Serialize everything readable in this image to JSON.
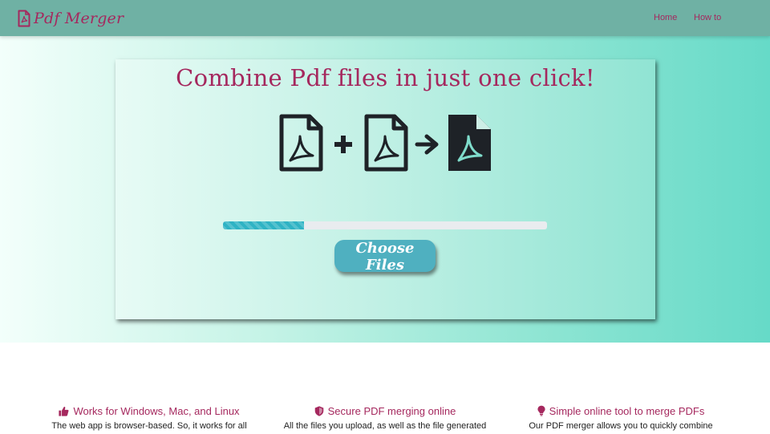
{
  "header": {
    "brand": "Pdf Merger",
    "nav": {
      "home": "Home",
      "howto": "How to"
    }
  },
  "hero": {
    "title": "Combine Pdf files in just one click!",
    "progress": {
      "percent": 25
    },
    "choose_button": "Choose Files"
  },
  "features": [
    {
      "title": "Works for Windows, Mac, and Linux",
      "desc": "The web app is browser-based. So, it works for all",
      "icon": "thumbs-up-icon"
    },
    {
      "title": "Secure PDF merging online",
      "desc": "All the files you upload, as well as the file generated",
      "icon": "shield-icon"
    },
    {
      "title": "Simple online tool to merge PDFs",
      "desc": "Our PDF merger allows you to quickly combine",
      "icon": "lightbulb-icon"
    }
  ],
  "colors": {
    "accent": "#a5285e",
    "navbar": "#6fb1a4",
    "button": "#4fb0c0",
    "progress": "#2fb3c4",
    "icon_dark": "#1e2227",
    "icon_symbol": "#7fdccb"
  }
}
